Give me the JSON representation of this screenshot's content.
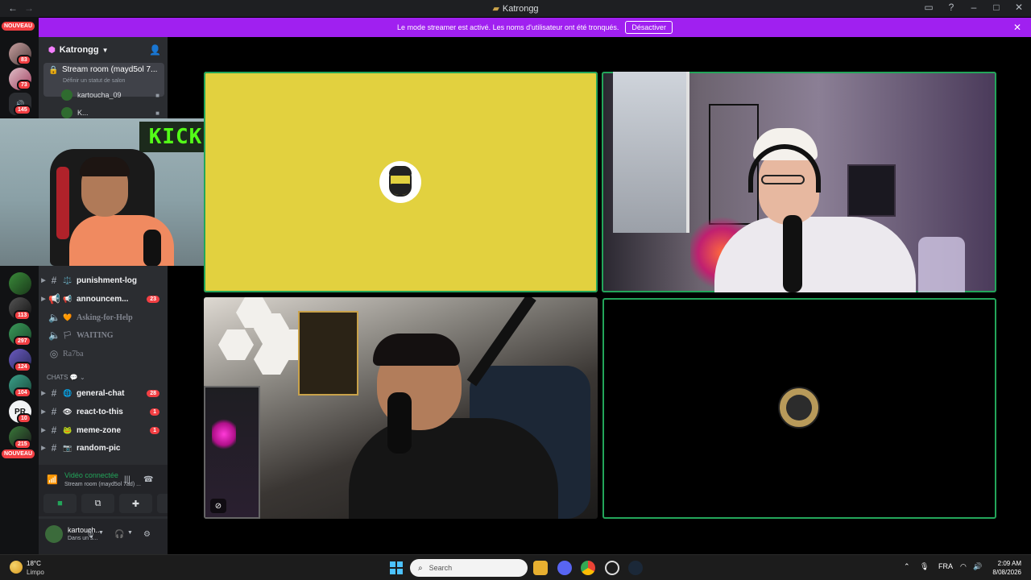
{
  "titlebar": {
    "title": "Katrongg",
    "back_icon": "←",
    "forward_icon": "→"
  },
  "banner": {
    "message": "Le mode streamer est activé. Les noms d'utilisateur ont été tronqués.",
    "button": "Désactiver",
    "color": "#a020f0"
  },
  "rail": {
    "new_label": "NOUVEAU",
    "servers": [
      {
        "badge": "83"
      },
      {
        "badge": "73"
      },
      {
        "badge": "145"
      },
      {
        "badge": "113"
      },
      {
        "badge": "297"
      },
      {
        "badge": "124"
      },
      {
        "badge": "104"
      },
      {
        "badge": "10"
      },
      {
        "badge": "215"
      }
    ],
    "new_label_bottom": "NOUVEAU"
  },
  "sidebar": {
    "guild_name": "Katrongg",
    "stream_channel": {
      "name": "Stream room (mayd5ol 7...",
      "status": "Définir un statut de salon"
    },
    "voice_users": [
      {
        "name": "kartoucha_09"
      },
      {
        "name": "K..."
      }
    ],
    "channels": [
      {
        "emoji": "⚖️",
        "name": "punishment-log",
        "count": ""
      },
      {
        "emoji": "📢",
        "name": "announcem...",
        "count": "23"
      },
      {
        "emoji": "🧡",
        "name": "Asking-for-Help",
        "count": ""
      },
      {
        "emoji": "🏳",
        "name": "WAITING",
        "count": ""
      },
      {
        "emoji": "",
        "name": "Ra7ba",
        "count": ""
      }
    ],
    "category": "CHATS",
    "chat_channels": [
      {
        "emoji": "🌐",
        "name": "general-chat",
        "count": "28"
      },
      {
        "emoji": "👁",
        "name": "react-to-this",
        "count": "1"
      },
      {
        "emoji": "🐸",
        "name": "meme-zone",
        "count": "1"
      },
      {
        "emoji": "📷",
        "name": "random-pic",
        "count": ""
      }
    ],
    "voice_panel": {
      "title": "Vidéo connectée",
      "subtitle": "Stream room (mayd5ol 7ad) ..."
    },
    "user_panel": {
      "name": "kartouch...",
      "status": "Dans un s..."
    }
  },
  "selfview": {
    "logo_text": "KICK"
  },
  "taskbar": {
    "weather_temp": "18°C",
    "weather_desc": "Limpo",
    "search_placeholder": "Search",
    "lang": "FRA",
    "time": "2:09 AM",
    "date": "8/08/2026"
  },
  "colors": {
    "speaking": "#23a55a",
    "badge": "#f23f43",
    "tile1_bg": "#e2d13f"
  }
}
